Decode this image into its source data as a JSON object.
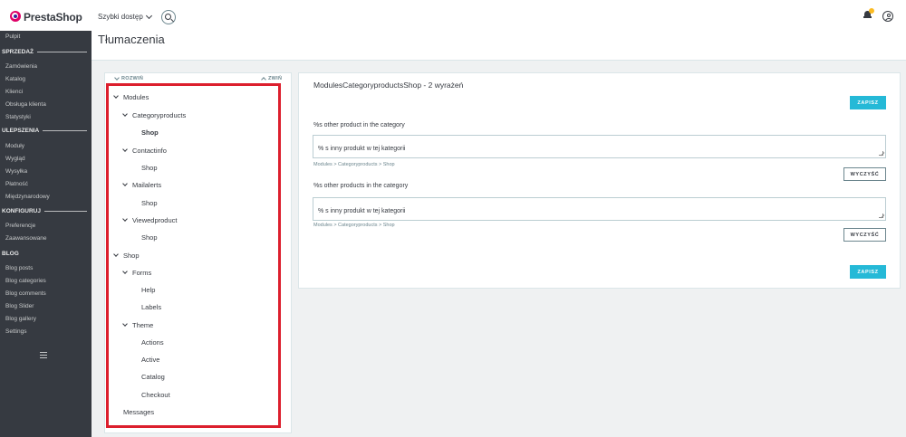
{
  "header": {
    "logo_text": "PrestaShop",
    "quick_access": "Szybki dostęp",
    "notification_badge_color": "#fbbb22"
  },
  "page": {
    "title": "Tłumaczenia"
  },
  "sidebar": {
    "dashboard": "Pulpit",
    "sections": [
      {
        "title": "SPRZEDAŻ",
        "items": [
          "Zamówienia",
          "Katalog",
          "Klienci",
          "Obsługa klienta",
          "Statystyki"
        ]
      },
      {
        "title": "ULEPSZENIA",
        "items": [
          "Moduły",
          "Wygląd",
          "Wysyłka",
          "Płatność",
          "Międzynarodowy"
        ]
      },
      {
        "title": "KONFIGURUJ",
        "items": [
          "Preferencje",
          "Zaawansowane"
        ]
      },
      {
        "title": "BLOG",
        "items": [
          "Blog posts",
          "Blog categories",
          "Blog comments",
          "Blog Slider",
          "Blog gallery",
          "Settings"
        ]
      }
    ]
  },
  "tree": {
    "expand_label": "ROZWIŃ",
    "collapse_label": "ZWIŃ",
    "highlight_color": "#dc1f2d",
    "nodes": [
      "Modules",
      "Categoryproducts",
      "Shop",
      "Contactinfo",
      "Shop",
      "Mailalerts",
      "Shop",
      "Viewedproduct",
      "Shop",
      "Shop",
      "Forms",
      "Help",
      "Labels",
      "Theme",
      "Actions",
      "Active",
      "Catalog",
      "Checkout",
      "Messages"
    ]
  },
  "editor": {
    "heading": "ModulesCategoryproductsShop - 2 wyrażeń",
    "save_label": "ZAPISZ",
    "clear_label": "WYCZYŚĆ",
    "accent_color": "#25b9d7",
    "fields": [
      {
        "label": "%s other product in the category",
        "value": "% s inny produkt w tej kategorii",
        "path": "Modules > Categoryproducts > Shop"
      },
      {
        "label": "%s other products in the category",
        "value": "% s inny produkt w tej kategorii",
        "path": "Modules > Categoryproducts > Shop"
      }
    ]
  }
}
